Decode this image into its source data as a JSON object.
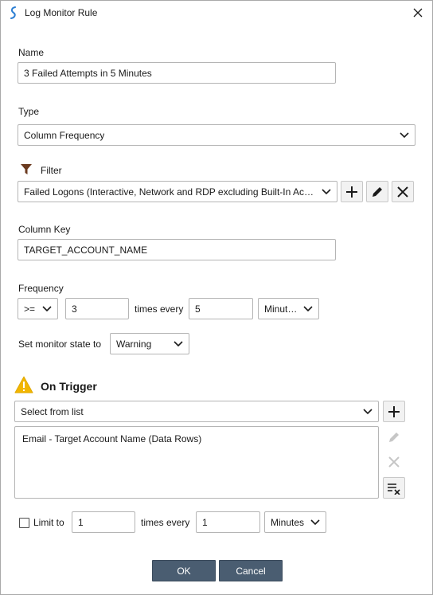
{
  "window": {
    "title": "Log Monitor Rule"
  },
  "name": {
    "label": "Name",
    "value": "3 Failed Attempts in 5 Minutes"
  },
  "type": {
    "label": "Type",
    "value": "Column Frequency"
  },
  "filter": {
    "label": "Filter",
    "value": "Failed Logons (Interactive, Network and RDP excluding Built-In Acc..."
  },
  "column_key": {
    "label": "Column Key",
    "value": "TARGET_ACCOUNT_NAME"
  },
  "frequency": {
    "label": "Frequency",
    "operator": ">=",
    "count": "3",
    "times_every_label": "times every",
    "interval": "5",
    "unit": "Minutes"
  },
  "monitor_state": {
    "label": "Set monitor state to",
    "value": "Warning"
  },
  "on_trigger": {
    "title": "On Trigger",
    "select_placeholder": "Select from list",
    "actions": [
      "Email - Target Account Name (Data Rows)"
    ]
  },
  "limit": {
    "label": "Limit to",
    "checked": false,
    "count": "1",
    "times_every_label": "times every",
    "interval": "1",
    "unit": "Minutes"
  },
  "buttons": {
    "ok": "OK",
    "cancel": "Cancel"
  },
  "colors": {
    "accent": "#4a5d71",
    "warning": "#f2b600",
    "filter_icon": "#6b3a1f",
    "app_icon": "#2d7fd3"
  },
  "icons": {
    "app": "app-logo-icon",
    "close": "close-icon",
    "filter": "funnel-icon",
    "add": "plus-icon",
    "edit": "pencil-icon",
    "remove": "x-icon",
    "clear": "clear-list-icon",
    "warning": "warning-icon",
    "dropdown": "chevron-down-icon"
  }
}
